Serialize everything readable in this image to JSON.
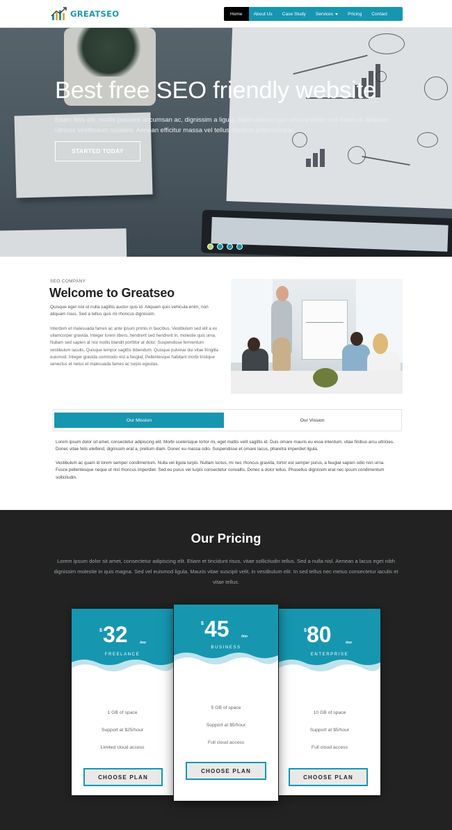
{
  "brand": {
    "name": "GREATSEO",
    "accent": "#1796b0"
  },
  "nav": {
    "items": [
      {
        "label": "Home",
        "active": true
      },
      {
        "label": "About Us"
      },
      {
        "label": "Case Study"
      },
      {
        "label": "Services"
      },
      {
        "label": "Pricing"
      },
      {
        "label": "Contact"
      }
    ]
  },
  "hero": {
    "title": "Best free SEO friendly website",
    "text": "Etiam felis elit, mollis posuere accumsan ac, dignissim a ligula. Nam ullamcorper ornare tortor sed dapibus. Aliquam ultrices vestibulum sodales. Aenean efficitur massa vel tellus dapibus pellentesque.",
    "button": "STARTED TODAY",
    "slides": 4,
    "active_slide": 1
  },
  "welcome": {
    "label": "SEO COMPANY",
    "title": "Welcome to Greatseo",
    "intro": "Quisque eget nisl id nulla sagittis auctor quis id. Aliquam quis vehicula enim, non aliquam risus. Sed a tellus quis mi rhoncus dignissim.",
    "body": "Interdum et malesuada fames ac ante ipsum primis in faucibus. Vestibulum sed elit a ex ullamcorper gravida. Integer lorem libero, hendrerit sed hendrerit in, molestie quis urna. Nullam sed sapien at nisl mollis blandit porttitor at dolor. Suspendisse fermentum vestibulum iaculis. Quisque tempor sagittis bibendum. Quisque pulvinar dui vitae fringilla euismod. Integer gravida commodo nisl a feugiat. Pellentesque habitant morbi tristique senectus et netus et malesuada fames ac turpis egestas."
  },
  "tabs": {
    "items": [
      "Our Mission",
      "Our Vission"
    ],
    "paragraphs": [
      "Lorem ipsum dolor sit amet, consectetur adipiscing elit. Morbi scelerisque tortor mi, eget mattis velit sagittis id. Duis ornare mauris eu esse interdum, vitae finibus arcu ultricies. Donec vitae felis eleifend, dignissim erat a, pretium diam. Donec eu massa odio. Suspendisse et ornare lacus, pharetra imperdiet ligula.",
      "Vestibulum ac quam id lorem semper condimentum. Nulla vel ligula turpis. Nullam luctus, mi nec rhoncus gravida, tortor est semper purus, a feugiat sapien odio non urna. Fusce pellentesque neque ut nisl rhoncus imperdiet. Sed eu purus vel turpis consectetur convallis. Donec a dolor tellus. Phasellus dignissim erat nec ipsum condimentum sollicitudin."
    ]
  },
  "pricing": {
    "title": "Our Pricing",
    "description": "Lorem ipsum dolor sit amet, consectetur adipiscing elit. Etiam et tincidunt risus, vitae sollicitudin tellus. Sed a nulla nisl. Aenean a lacus eget nibh dignissim molestie in quis magna. Sed vel euismod ligula. Mauris vitae suscipit velit, in vestibulum elit. In sed tellus nec metus consectetur iaculis et vitae tellus.",
    "plans": [
      {
        "currency": "$",
        "price": "32",
        "period": "/mo",
        "name": "FREELANCE",
        "features": [
          "1 GB of space",
          "Support at $25/hour",
          "Limited cloud access"
        ],
        "button": "CHOOSE PLAN"
      },
      {
        "currency": "$",
        "price": "45",
        "period": "/mo",
        "name": "BUSINESS",
        "features": [
          "5 GB of space",
          "Support at $5/hour",
          "Full cloud access"
        ],
        "button": "CHOOSE PLAN"
      },
      {
        "currency": "$",
        "price": "80",
        "period": "/mo",
        "name": "ENTERPRISE",
        "features": [
          "10 GB of space",
          "Support at $5/hour",
          "Full cloud access"
        ],
        "button": "CHOOSE PLAN"
      }
    ]
  }
}
